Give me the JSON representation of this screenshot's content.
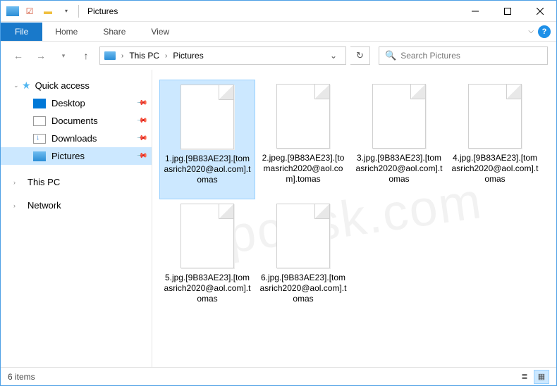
{
  "window": {
    "title": "Pictures"
  },
  "ribbon": {
    "file": "File",
    "tabs": [
      "Home",
      "Share",
      "View"
    ]
  },
  "address": {
    "crumbs": [
      "This PC",
      "Pictures"
    ],
    "search_placeholder": "Search Pictures"
  },
  "nav": {
    "quick_access": "Quick access",
    "items": [
      {
        "label": "Desktop",
        "icon": "desktop",
        "pinned": true
      },
      {
        "label": "Documents",
        "icon": "docs",
        "pinned": true
      },
      {
        "label": "Downloads",
        "icon": "down",
        "pinned": true
      },
      {
        "label": "Pictures",
        "icon": "pics",
        "pinned": true,
        "selected": true
      }
    ],
    "this_pc": "This PC",
    "network": "Network"
  },
  "files": [
    {
      "name": "1.jpg.[9B83AE23].[tomasrich2020@aol.com].tomas",
      "selected": true
    },
    {
      "name": "2.jpeg.[9B83AE23].[tomasrich2020@aol.com].tomas"
    },
    {
      "name": "3.jpg.[9B83AE23].[tomasrich2020@aol.com].tomas"
    },
    {
      "name": "4.jpg.[9B83AE23].[tomasrich2020@aol.com].tomas"
    },
    {
      "name": "5.jpg.[9B83AE23].[tomasrich2020@aol.com].tomas"
    },
    {
      "name": "6.jpg.[9B83AE23].[tomasrich2020@aol.com].tomas"
    }
  ],
  "status": {
    "count": "6 items"
  },
  "watermark": "pcrisk.com"
}
